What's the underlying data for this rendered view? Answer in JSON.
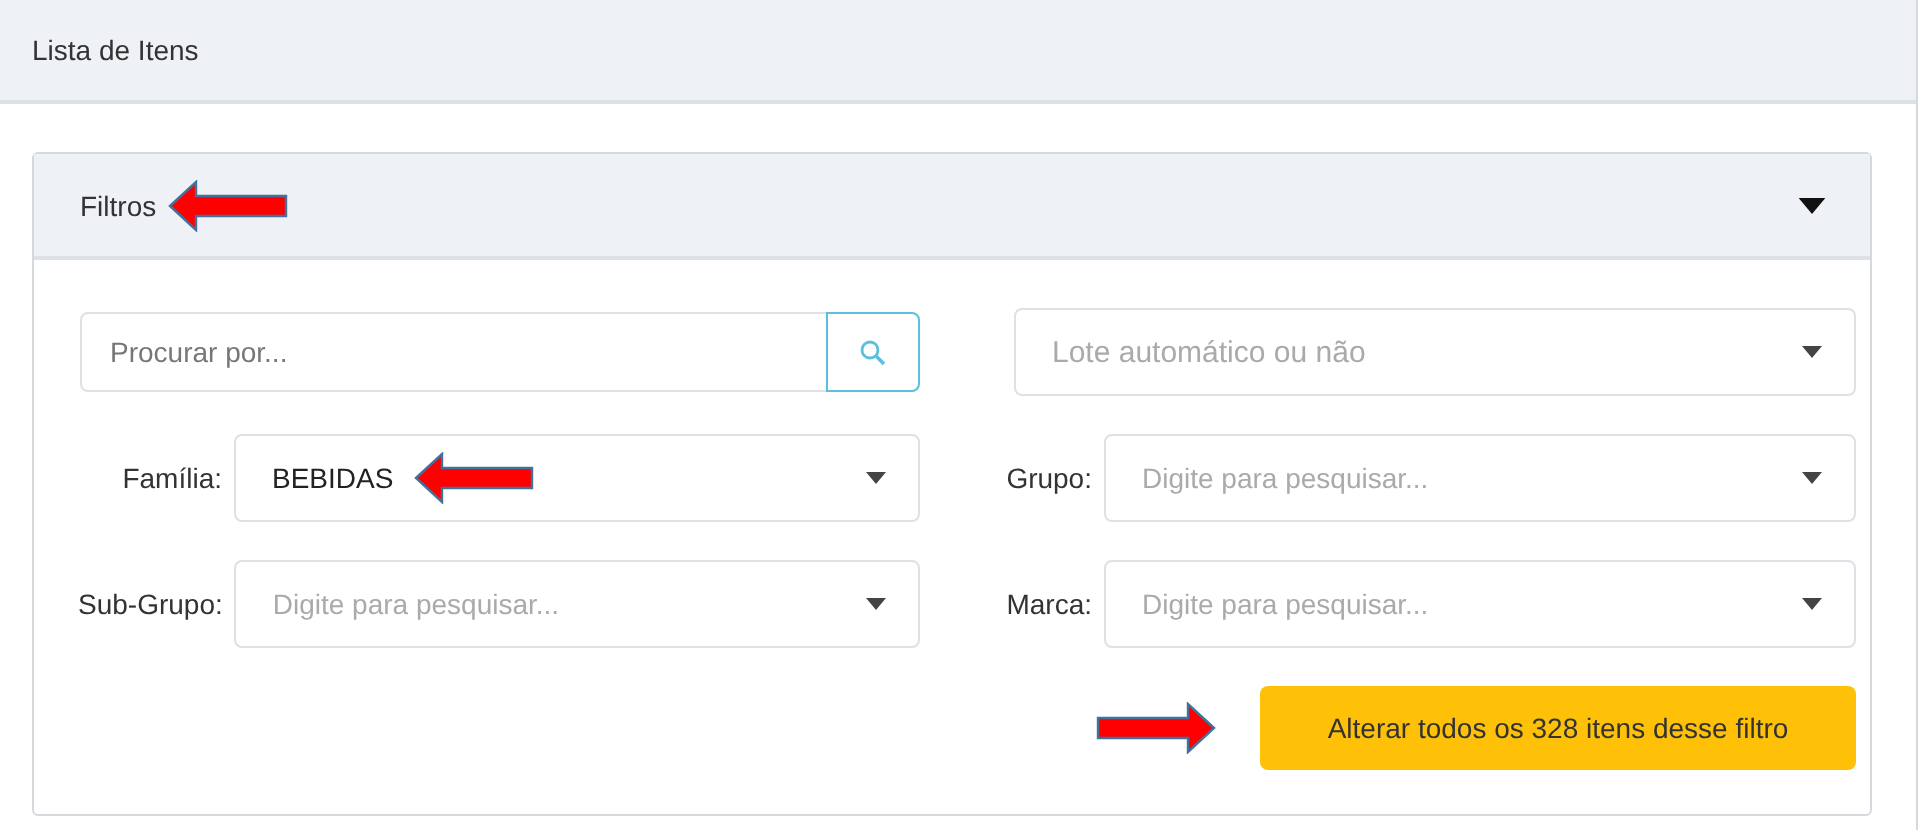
{
  "page": {
    "title": "Lista de Itens"
  },
  "filters": {
    "title": "Filtros",
    "expanded": true,
    "search": {
      "placeholder": "Procurar por..."
    },
    "lot_select": {
      "placeholder": "Lote automático ou não"
    },
    "fields": [
      {
        "label": "Família:",
        "value": "BEBIDAS",
        "annotated": true
      },
      {
        "label": "Grupo:",
        "placeholder": "Digite para pesquisar...",
        "annotated": false
      },
      {
        "label": "Sub-Grupo:",
        "placeholder": "Digite para pesquisar...",
        "annotated": false
      },
      {
        "label": "Marca:",
        "placeholder": "Digite para pesquisar...",
        "annotated": false
      }
    ],
    "apply_button": {
      "label": "Alterar todos os 328 itens desse filtro"
    }
  }
}
